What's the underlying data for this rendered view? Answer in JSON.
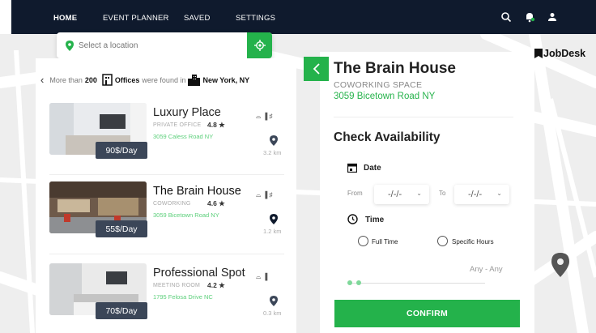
{
  "nav": {
    "items": [
      "HOME",
      "EVENT PLANNER",
      "SAVED",
      "SETTINGS"
    ],
    "icons": [
      "search-icon",
      "notification-bell-icon",
      "user-icon"
    ]
  },
  "location_search": {
    "placeholder": "Select a location",
    "locate_icon": "crosshair-icon"
  },
  "results": {
    "prefix": "More than",
    "count": "200",
    "category": "Offices",
    "middle": "were found in",
    "city": "New York, NY",
    "cards": [
      {
        "title": "Luxury Place",
        "type": "PRIVATE OFFICE",
        "rating": "4.8 ★",
        "address": "3059 Caless Road NY",
        "price": "90$/Day",
        "distance": "3.2 km",
        "amenities": "⌓ ▐ ♯"
      },
      {
        "title": "The Brain House",
        "type": "COWORKING",
        "rating": "4.6 ★",
        "address": "3059 Bicetown Road NY",
        "price": "55$/Day",
        "distance": "1.2 km",
        "amenities": "⌓ ▐ ♯"
      },
      {
        "title": "Professional Spot",
        "type": "MEETING ROOM",
        "rating": "4.2 ★",
        "address": "1795 Felosa Drive NC",
        "price": "70$/Day",
        "distance": "0.3 km",
        "amenities": "⌓ ▐"
      }
    ]
  },
  "detail": {
    "title": "The Brain House",
    "type": "COWORKING SPACE",
    "address": "3059 Bicetown Road NY",
    "check_heading": "Check Availability",
    "date_label": "Date",
    "from_label": "From",
    "to_label": "To",
    "from_value": "-/-/-",
    "to_value": "-/-/-",
    "time_label": "Time",
    "full_time": "Full Time",
    "specific_hours": "Specific Hours",
    "range_value": "Any - Any",
    "confirm_label": "CONFIRM"
  },
  "brand": {
    "name": "JobDesk"
  },
  "colors": {
    "accent_green": "#24b24b",
    "nav_bg": "#0f1a2d",
    "price_tag_bg": "#3b4658"
  }
}
